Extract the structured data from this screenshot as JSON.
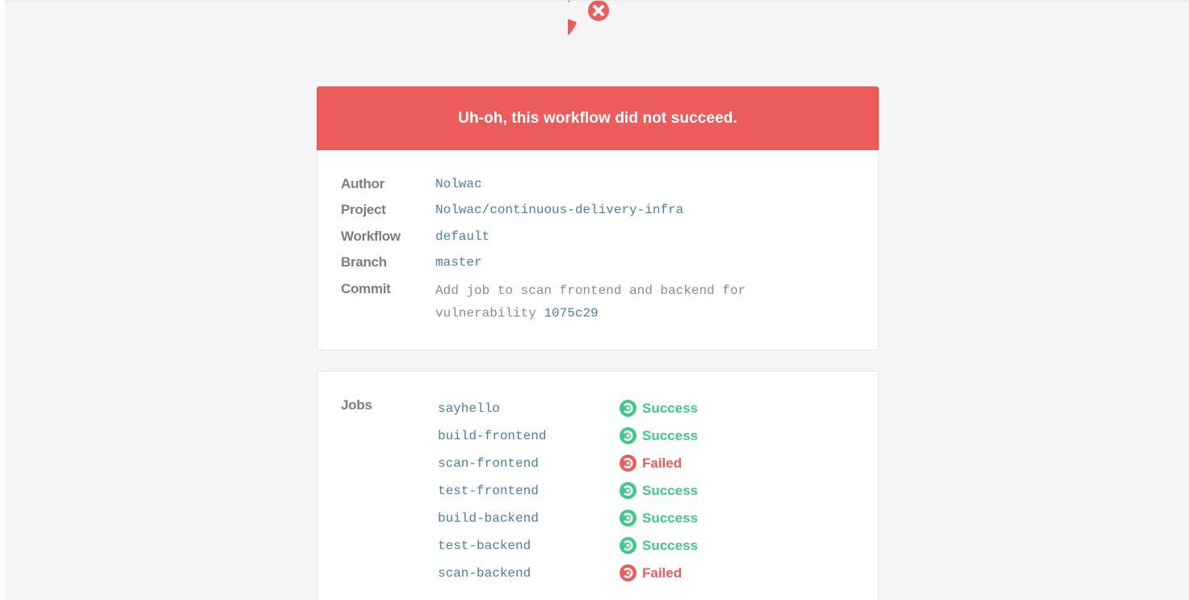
{
  "colors": {
    "failed": "#ed5c5c",
    "success": "#42c88a",
    "link": "#4a7fa7",
    "label": "#7e7e7e",
    "background": "#f5f5f5"
  },
  "header": {
    "logo_icon": "circleci-failed-icon"
  },
  "banner": {
    "message": "Uh-oh, this workflow did not succeed."
  },
  "details": {
    "author_label": "Author",
    "author_value": "Nolwac",
    "project_label": "Project",
    "project_value": "Nolwac/continuous-delivery-infra",
    "workflow_label": "Workflow",
    "workflow_value": "default",
    "branch_label": "Branch",
    "branch_value": "master",
    "commit_label": "Commit",
    "commit_message_line1": "Add job to scan frontend and backend for",
    "commit_message_line2": "vulnerability",
    "commit_hash": "1075c29"
  },
  "jobs": {
    "label": "Jobs",
    "items": [
      {
        "name": "sayhello",
        "status": "Success",
        "state": "success",
        "icon": "success-icon"
      },
      {
        "name": "build-frontend",
        "status": "Success",
        "state": "success",
        "icon": "success-icon"
      },
      {
        "name": "scan-frontend",
        "status": "Failed",
        "state": "failed",
        "icon": "failed-icon"
      },
      {
        "name": "test-frontend",
        "status": "Success",
        "state": "success",
        "icon": "success-icon"
      },
      {
        "name": "build-backend",
        "status": "Success",
        "state": "success",
        "icon": "success-icon"
      },
      {
        "name": "test-backend",
        "status": "Success",
        "state": "success",
        "icon": "success-icon"
      },
      {
        "name": "scan-backend",
        "status": "Failed",
        "state": "failed",
        "icon": "failed-icon"
      }
    ]
  }
}
